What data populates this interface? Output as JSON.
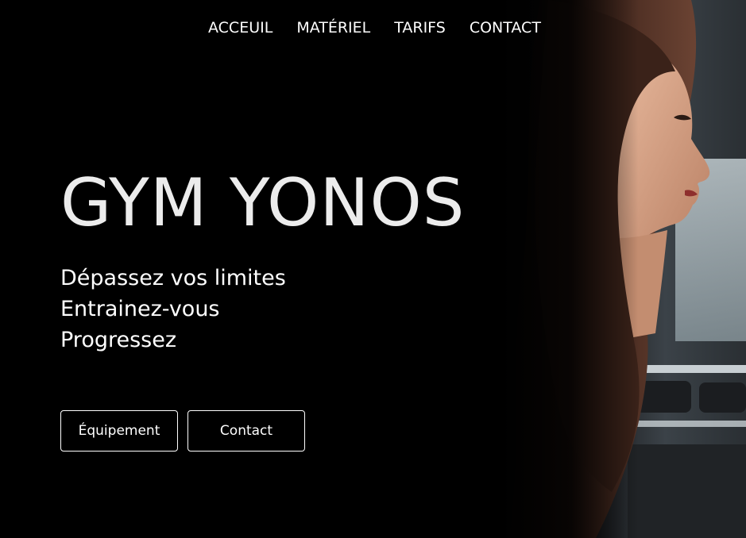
{
  "nav": {
    "items": [
      {
        "label": "ACCEUIL"
      },
      {
        "label": "MATÉRIEL"
      },
      {
        "label": "TARIFS"
      },
      {
        "label": "CONTACT"
      }
    ]
  },
  "hero": {
    "title": "GYM YONOS",
    "taglines": [
      "Dépassez vos limites",
      "Entrainez-vous",
      "Progressez"
    ]
  },
  "buttons": {
    "equipement": "Équipement",
    "contact": "Contact"
  },
  "colors": {
    "background": "#000000",
    "text": "#ffffff",
    "title": "#ececec"
  }
}
